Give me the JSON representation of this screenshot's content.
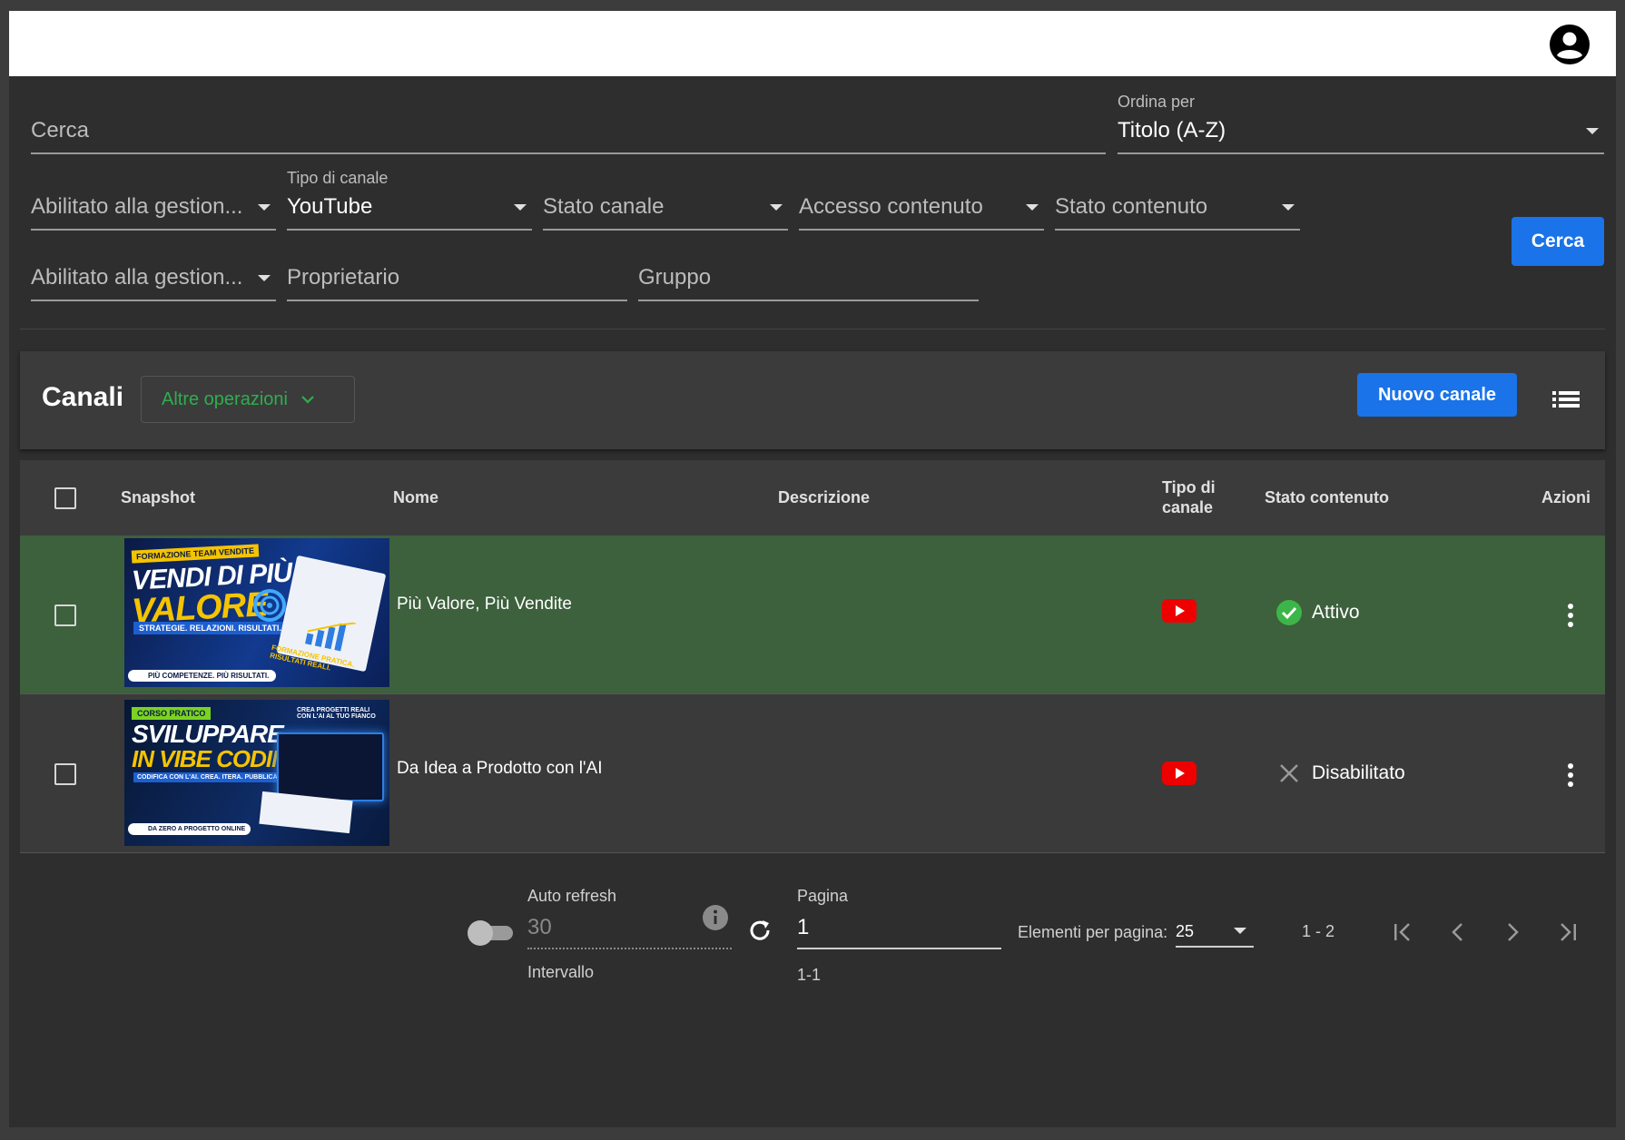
{
  "header": {
    "account_icon": "account-circle-icon"
  },
  "filters": {
    "search_placeholder": "Cerca",
    "sort_label": "Ordina per",
    "sort_value": "Titolo (A-Z)",
    "managed1_placeholder": "Abilitato alla gestion...",
    "channel_type_label": "Tipo di canale",
    "channel_type_value": "YouTube",
    "channel_state_placeholder": "Stato canale",
    "content_access_placeholder": "Accesso contenuto",
    "content_state_placeholder": "Stato contenuto",
    "managed2_placeholder": "Abilitato alla gestion...",
    "owner_placeholder": "Proprietario",
    "group_placeholder": "Gruppo",
    "search_button": "Cerca"
  },
  "panel": {
    "title": "Canali",
    "more_ops": "Altre operazioni",
    "new_channel": "Nuovo canale",
    "view_icon": "list-view-icon"
  },
  "table": {
    "columns": {
      "snapshot": "Snapshot",
      "name": "Nome",
      "description": "Descrizione",
      "type": "Tipo di canale",
      "content_state": "Stato contenuto",
      "actions": "Azioni"
    },
    "rows": [
      {
        "name": "Più Valore, Più Vendite",
        "description": "",
        "type_icon": "youtube-icon",
        "status": "Attivo",
        "status_icon": "check-circle-icon",
        "selected": true,
        "thumb": {
          "tag": "FORMAZIONE TEAM VENDITE",
          "line1": "VENDI DI PIÙ",
          "line2": "VALORE",
          "sub": "STRATEGIE. RELAZIONI. RISULTATI.",
          "foot": "PIÙ COMPETENZE. PIÙ RISULTATI.",
          "side": "FORMAZIONE PRATICA. RISULTATI REALI."
        }
      },
      {
        "name": "Da Idea a Prodotto con l'AI",
        "description": "",
        "type_icon": "youtube-icon",
        "status": "Disabilitato",
        "status_icon": "close-icon",
        "selected": false,
        "thumb": {
          "tag": "CORSO PRATICO",
          "line1": "SVILUPPARE",
          "line2": "IN VIBE CODING",
          "sub": "CODIFICA CON L'AI. CREA. ITERA. PUBBLICA.",
          "foot": "DA ZERO A PROGETTO ONLINE",
          "side": "CREA PROGETTI REALI CON L'AI AL TUO FIANCO"
        }
      }
    ]
  },
  "footer": {
    "auto_refresh_label": "Auto refresh",
    "interval_value": "30",
    "interval_label": "Intervallo",
    "page_label": "Pagina",
    "page_value": "1",
    "page_range": "1-1",
    "per_page_label": "Elementi per pagina:",
    "per_page_value": "25",
    "items_range": "1 - 2"
  }
}
